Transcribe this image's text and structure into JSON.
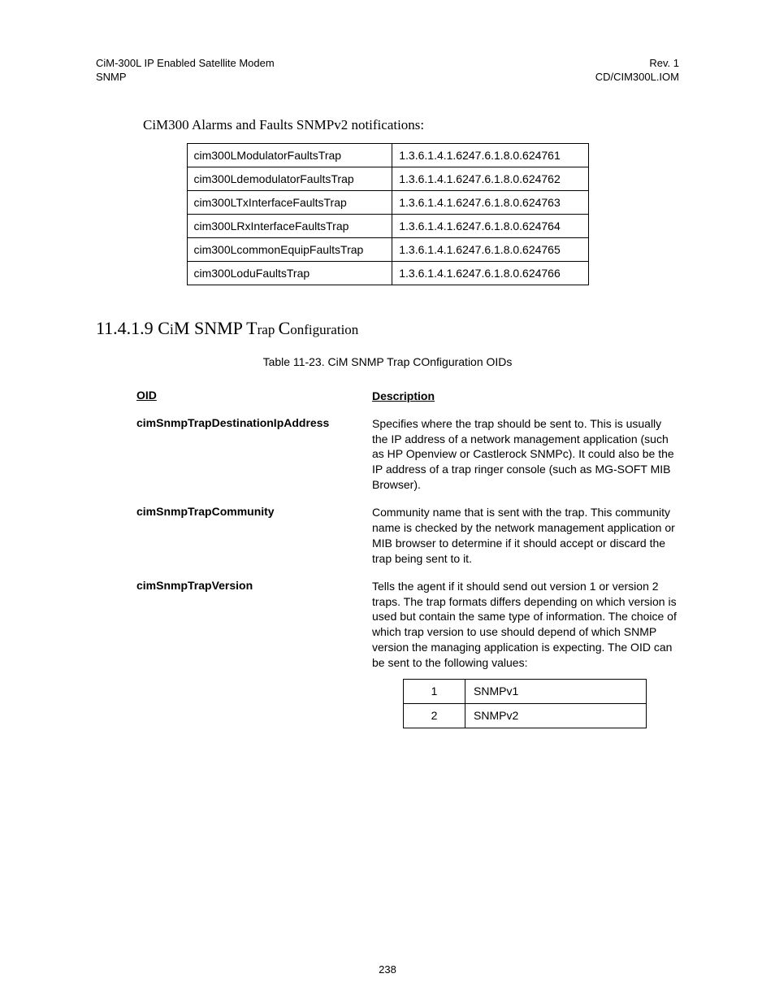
{
  "header": {
    "left_line1": "CiM-300L IP Enabled Satellite Modem",
    "left_line2": "SNMP",
    "right_line1": "Rev. 1",
    "right_line2": "CD/CIM300L.IOM"
  },
  "intro_title": "CiM300 Alarms and Faults SNMPv2 notifications:",
  "traps": [
    {
      "name": "cim300LModulatorFaultsTrap",
      "oid": "1.3.6.1.4.1.6247.6.1.8.0.624761"
    },
    {
      "name": "cim300LdemodulatorFaultsTrap",
      "oid": "1.3.6.1.4.1.6247.6.1.8.0.624762"
    },
    {
      "name": "cim300LTxInterfaceFaultsTrap",
      "oid": "1.3.6.1.4.1.6247.6.1.8.0.624763"
    },
    {
      "name": "cim300LRxInterfaceFaultsTrap",
      "oid": "1.3.6.1.4.1.6247.6.1.8.0.624764"
    },
    {
      "name": "cim300LcommonEquipFaultsTrap",
      "oid": "1.3.6.1.4.1.6247.6.1.8.0.624765"
    },
    {
      "name": "cim300LoduFaultsTrap",
      "oid": "1.3.6.1.4.1.6247.6.1.8.0.624766"
    }
  ],
  "section_number": "11.4.1.9 ",
  "section_title_1": "C",
  "section_title_2": "i",
  "section_title_3": "M SNMP T",
  "section_title_4": "rap ",
  "section_title_5": "C",
  "section_title_6": "onfiguration",
  "table_caption": "Table 11-23.  CiM SNMP Trap COnfiguration OIDs",
  "oid_header": {
    "name": "OID",
    "desc": "Description"
  },
  "oid_rows": [
    {
      "name": "cimSnmpTrapDestinationIpAddress",
      "desc": "Specifies where the trap should be sent to.  This is usually the IP address of a network management application (such as HP Openview or Castlerock SNMPc).  It could also be the IP address of a trap ringer console (such as MG-SOFT MIB Browser)."
    },
    {
      "name": "cimSnmpTrapCommunity",
      "desc": "Community name that is sent with the trap.  This community name is checked by the network management application or MIB browser to determine if it should accept or discard the trap being sent to it."
    },
    {
      "name": "cimSnmpTrapVersion",
      "desc": "Tells the agent if it should send out version 1 or version 2 traps.  The trap formats differs depending on which version is used but contain the same type of information.  The choice of which trap version to use should depend of which SNMP version the managing application is expecting.  The OID can be sent to the following values:"
    }
  ],
  "version_table": [
    {
      "num": "1",
      "label": "SNMPv1"
    },
    {
      "num": "2",
      "label": "SNMPv2"
    }
  ],
  "page_number": "238"
}
